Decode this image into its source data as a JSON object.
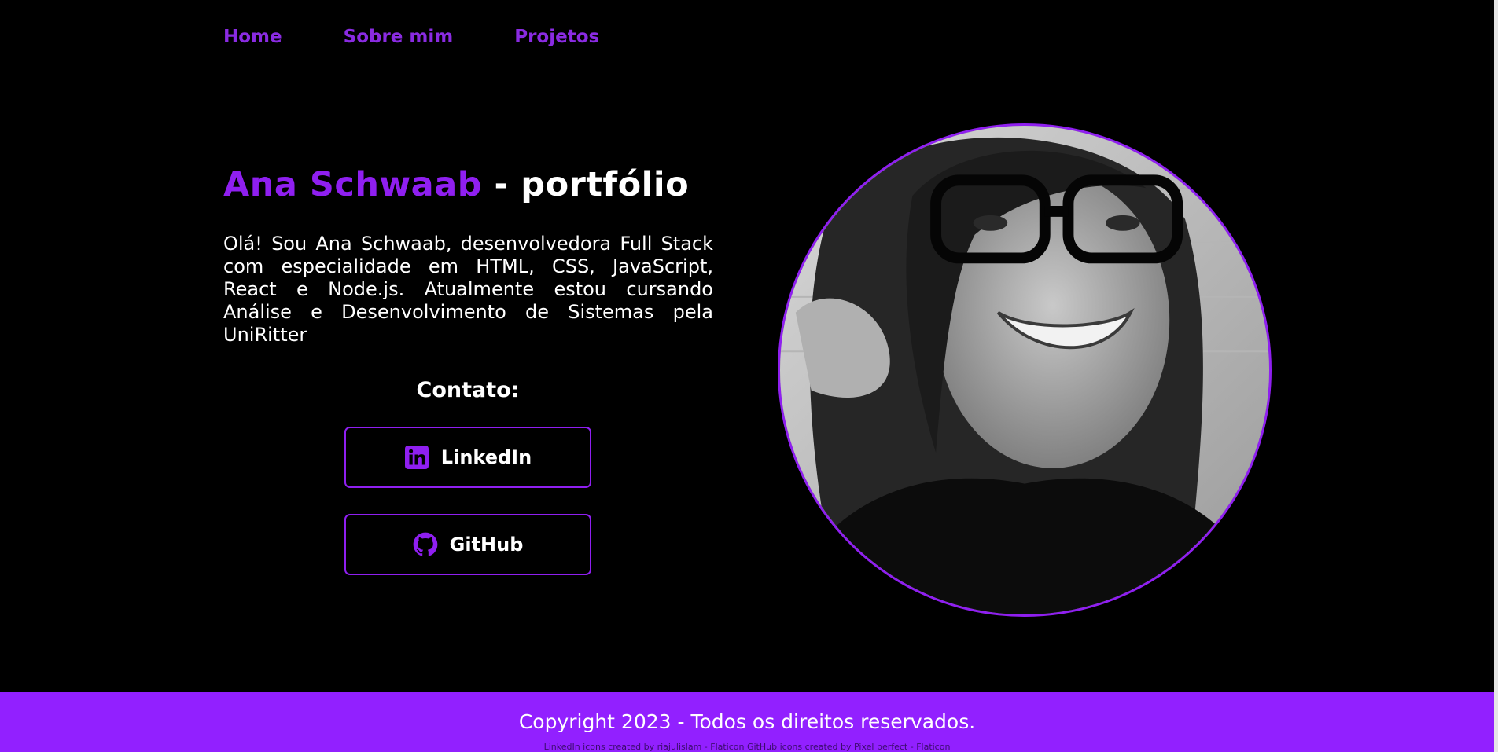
{
  "nav": {
    "home": "Home",
    "about": "Sobre mim",
    "projects": "Projetos"
  },
  "hero": {
    "name": "Ana Schwaab",
    "separator": " - ",
    "suffix": "portfólio",
    "intro": "Olá! Sou Ana Schwaab, desenvolvedora Full Stack com especialidade em HTML, CSS, JavaScript, React e Node.js. Atualmente estou cursando Análise e Desenvolvimento de Sistemas pela UniRitter"
  },
  "contact": {
    "title": "Contato:",
    "linkedin": "LinkedIn",
    "github": "GitHub"
  },
  "footer": {
    "copyright": "Copyright 2023 - Todos os direitos reservados.",
    "credits": "LinkedIn icons created by riajulislam - Flaticon GitHub icons created by Pixel perfect - Flaticon"
  },
  "colors": {
    "accent": "#8f1ff0",
    "footer_bg": "#9220ff",
    "background": "#000000"
  },
  "icons": {
    "linkedin": "linkedin-icon",
    "github": "github-icon"
  }
}
